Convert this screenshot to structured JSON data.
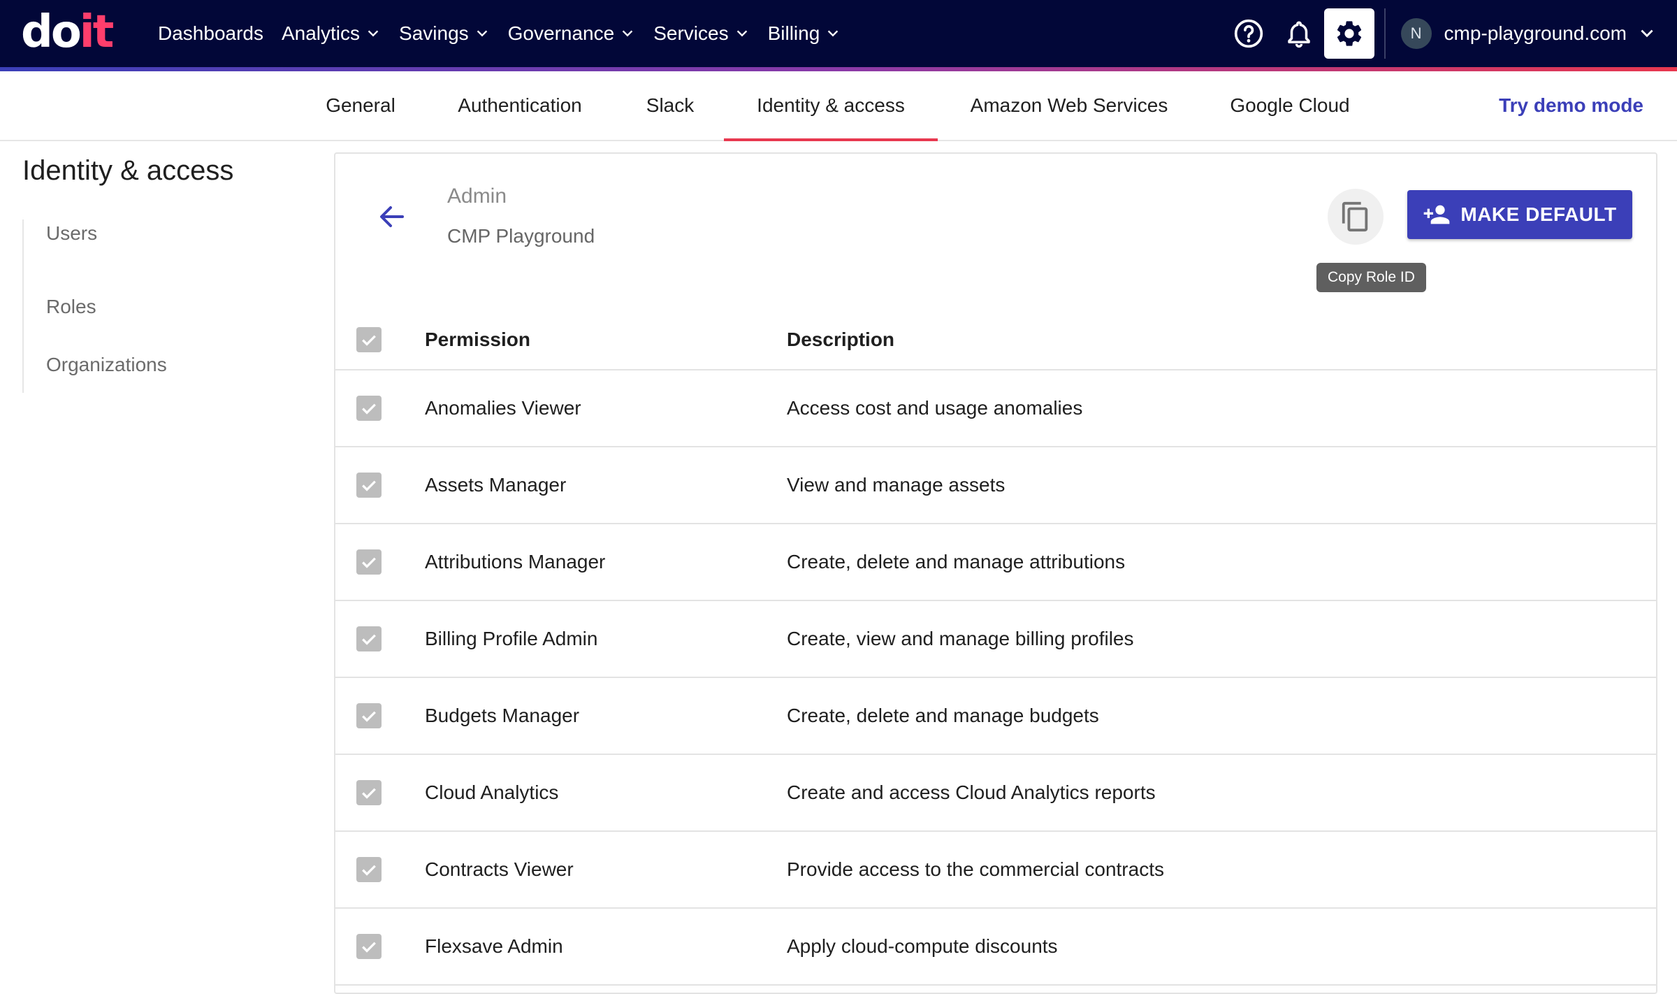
{
  "app": {
    "logo_do": "do",
    "logo_it": "it",
    "nav": [
      {
        "label": "Dashboards",
        "has_menu": false
      },
      {
        "label": "Analytics",
        "has_menu": true
      },
      {
        "label": "Savings",
        "has_menu": true
      },
      {
        "label": "Governance",
        "has_menu": true
      },
      {
        "label": "Services",
        "has_menu": true
      },
      {
        "label": "Billing",
        "has_menu": true
      }
    ],
    "account": {
      "avatar_initial": "N",
      "name": "cmp-playground.com"
    },
    "icons": [
      "help-icon",
      "bell-icon",
      "gear-icon",
      "chevron-down-icon"
    ]
  },
  "tabs": {
    "items": [
      "General",
      "Authentication",
      "Slack",
      "Identity & access",
      "Amazon Web Services",
      "Google Cloud"
    ],
    "selected": "Identity & access",
    "demo_link": "Try demo mode"
  },
  "sidebar": {
    "title": "Identity & access",
    "items": [
      "Users",
      "Roles",
      "Organizations"
    ]
  },
  "role": {
    "name": "Admin",
    "organization": "CMP Playground",
    "copy_tooltip": "Copy Role ID",
    "make_default_label": "MAKE DEFAULT"
  },
  "permissions": {
    "headers": {
      "permission": "Permission",
      "description": "Description"
    },
    "rows": [
      {
        "permission": "Anomalies Viewer",
        "description": "Access cost and usage anomalies",
        "checked": true
      },
      {
        "permission": "Assets Manager",
        "description": "View and manage assets",
        "checked": true
      },
      {
        "permission": "Attributions Manager",
        "description": "Create, delete and manage attributions",
        "checked": true
      },
      {
        "permission": "Billing Profile Admin",
        "description": "Create, view and manage billing profiles",
        "checked": true
      },
      {
        "permission": "Budgets Manager",
        "description": "Create, delete and manage budgets",
        "checked": true
      },
      {
        "permission": "Cloud Analytics",
        "description": "Create and access Cloud Analytics reports",
        "checked": true
      },
      {
        "permission": "Contracts Viewer",
        "description": "Provide access to the commercial contracts",
        "checked": true
      },
      {
        "permission": "Flexsave Admin",
        "description": "Apply cloud-compute discounts",
        "checked": true
      }
    ]
  },
  "colors": {
    "topbar": "#020738",
    "accent_red": "#e8384f",
    "primary": "#3b3fb8",
    "checkbox_disabled": "#bdbdbd"
  }
}
